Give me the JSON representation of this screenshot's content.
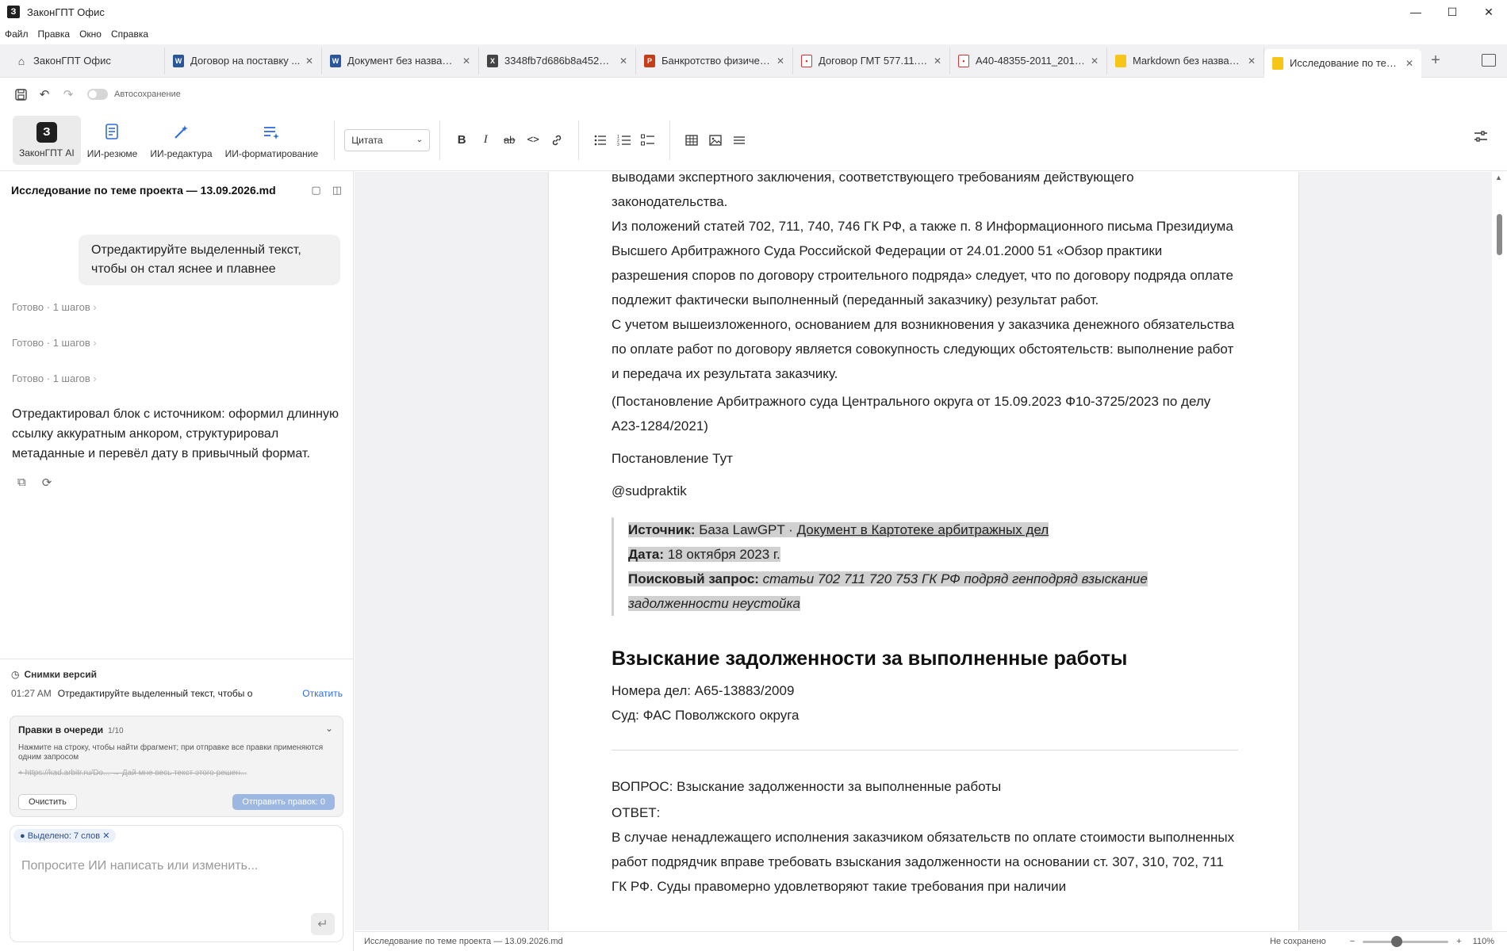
{
  "app": {
    "title": "ЗаконГПТ Офис",
    "logo_letter": "З",
    "window_controls": [
      "—",
      "☐",
      "✕"
    ]
  },
  "menu": [
    "Файл",
    "Правка",
    "Окно",
    "Справка"
  ],
  "tabs": [
    {
      "label": "ЗаконГПТ Офис",
      "icon": "home-icon"
    },
    {
      "label": "Договор на поставку ...",
      "icon": "word-icon"
    },
    {
      "label": "Документ без названия",
      "icon": "word-icon"
    },
    {
      "label": "3348fb7d686b8a4523e...",
      "icon": "excel-icon"
    },
    {
      "label": "Банкротство физическ...",
      "icon": "ppt-icon"
    },
    {
      "label": "Договор ГМТ 577.11.2...",
      "icon": "pdf-icon"
    },
    {
      "label": "А40-48355-2011_2018...",
      "icon": "pdf-icon"
    },
    {
      "label": "Markdown без названия",
      "icon": "markdown-icon"
    },
    {
      "label": "Исследование по теме...",
      "icon": "markdown-icon",
      "active": true
    }
  ],
  "quickbar": {
    "autosave_label": "Автосохранение",
    "autosave_on": false
  },
  "ribbon": {
    "ai_buttons": [
      {
        "label": "ЗаконГПТ AI"
      },
      {
        "label": "ИИ-резюме"
      },
      {
        "label": "ИИ-редактура"
      },
      {
        "label": "ИИ-форматирование"
      }
    ],
    "style_select": "Цитата",
    "format": {
      "bold": "B",
      "italic": "I",
      "strike": "ab"
    }
  },
  "sidebar": {
    "title": "Исследование по теме проекта — 13.09.2026.md",
    "user_message": "Отредактируйте выделенный текст, чтобы он стал яснее и плавнее",
    "steps": [
      "Готово · 1 шагов",
      "Готово · 1 шагов",
      "Готово · 1 шагов"
    ],
    "ai_reply": "Отредактировал блок с источником: оформил длинную ссылку аккуратным анкором, структурировал метаданные и перевёл дату в привычный формат.",
    "versions": {
      "title": "Снимки версий",
      "time": "01:27 AM",
      "text": "Отредактируйте выделенный текст, чтобы о",
      "rollback": "Откатить"
    },
    "queue": {
      "title": "Правки в очереди",
      "count": "1/10",
      "description": "Нажмите на строку, чтобы найти фрагмент; при отправке все правки применяются одним запросом",
      "item": "+ https://kad.arbitr.ru/Do... → Дай мне весь текст этого решен...",
      "clear": "Очистить",
      "send": "Отправить правок: 0"
    },
    "composer": {
      "chip": "Выделено: 7 слов",
      "placeholder": "Попросите ИИ написать или изменить..."
    }
  },
  "document": {
    "para1": "выводами экспертного заключения, соответствующего требованиям действующего законодательства.",
    "para2": "Из положений статей 702, 711, 740, 746 ГК РФ, а также п. 8 Информационного письма Президиума Высшего Арбитражного Суда Российской Федерации от 24.01.2000  51 «Обзор практики разрешения споров по договору строительного подряда» следует, что по договору подряда оплате подлежит фактически выполненный (переданный заказчику) результат работ.",
    "para3": "С учетом вышеизложенного, основанием для возникновения у заказчика денежного обязательства по оплате работ по договору является совокупность следующих обстоятельств: выполнение работ и передача их результата заказчику.",
    "para4": "(Постановление Арбитражного суда Центрального округа от 15.09.2023  Ф10-3725/2023 по делу  А23-1284/2021)",
    "para5": "Постановление Тут",
    "para6": "@sudpraktik",
    "quote": {
      "source_label": "Источник:",
      "source_value": "База LawGPT · ",
      "source_link": "Документ в Картотеке арбитражных дел",
      "date_label": "Дата:",
      "date_value": "18 октября 2023 г.",
      "query_label": "Поисковый запрос:",
      "query_value": "статьи 702 711 720 753 ГК РФ подряд генподряд взыскание задолженности неустойка"
    },
    "heading": "Взыскание задолженности за выполненные работы",
    "cases": "Номера дел: А65-13883/2009",
    "court": "Суд: ФАС Поволжского округа",
    "question": "ВОПРОС: Взыскание задолженности за выполненные работы",
    "answer_label": "ОТВЕТ:",
    "answer": "В случае ненадлежащего исполнения заказчиком обязательств по оплате стоимости выполненных работ подрядчик вправе требовать взыскания задолженности на основании ст. 307, 310, 702, 711 ГК РФ. Суды правомерно удовлетворяют такие требования при наличии"
  },
  "status": {
    "file": "Исследование по теме проекта — 13.09.2026.md",
    "saved": "Не сохранено",
    "zoom": "110%",
    "zoom_minus": "−",
    "zoom_plus": "+",
    "zoom_level": 0.4
  }
}
